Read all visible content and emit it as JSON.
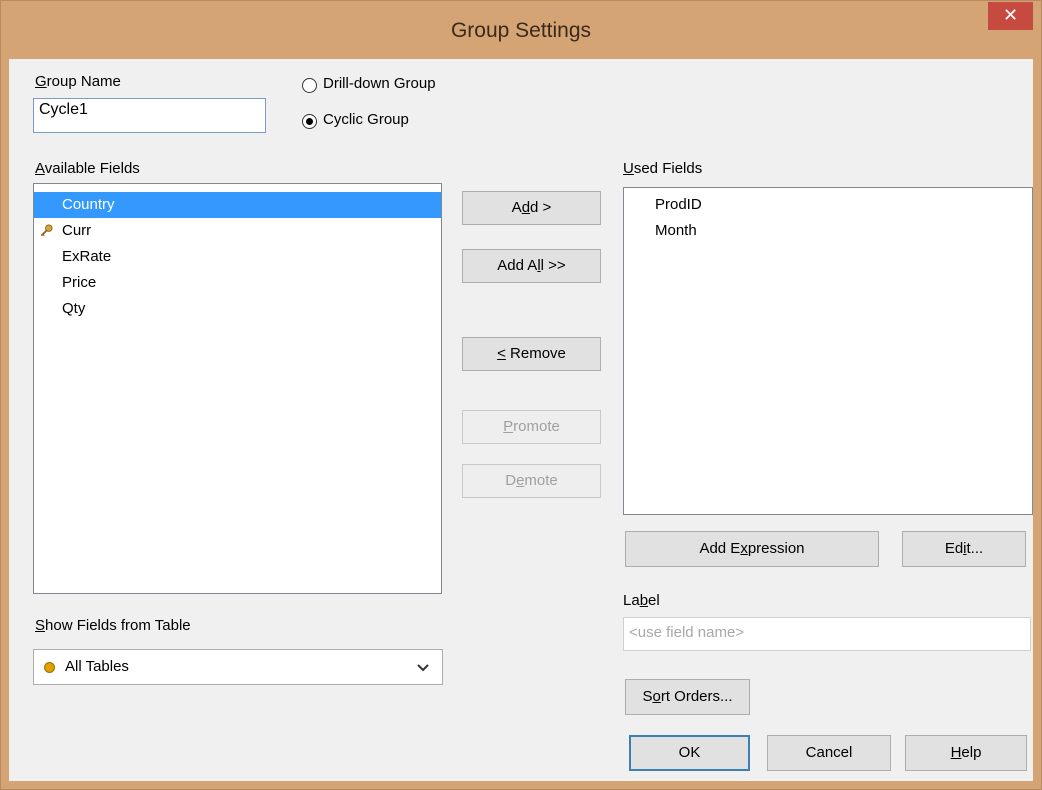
{
  "window": {
    "title": "Group Settings",
    "close_glyph": "✕"
  },
  "group_name": {
    "label_prefix": "",
    "label_key": "G",
    "label_rest": "roup Name",
    "value": "Cycle1"
  },
  "group_type": {
    "drilldown": "Drill-down Group",
    "cyclic": "Cyclic Group",
    "selected": "cyclic"
  },
  "available": {
    "label_key": "A",
    "label_rest": "vailable Fields",
    "items": [
      {
        "name": "Country",
        "selected": true,
        "key": false
      },
      {
        "name": "Curr",
        "selected": false,
        "key": true
      },
      {
        "name": "ExRate",
        "selected": false,
        "key": false
      },
      {
        "name": "Price",
        "selected": false,
        "key": false
      },
      {
        "name": "Qty",
        "selected": false,
        "key": false
      }
    ]
  },
  "buttons": {
    "add": {
      "a": "A",
      "k": "d",
      "b": "d >"
    },
    "add_all": {
      "a": "Add A",
      "k": "l",
      "b": "l >>"
    },
    "remove": {
      "a": "",
      "k": "<",
      "b": " Remove"
    },
    "promote": {
      "a": "",
      "k": "P",
      "b": "romote"
    },
    "demote": {
      "a": "D",
      "k": "e",
      "b": "mote"
    },
    "add_expression": {
      "a": "Add E",
      "k": "x",
      "b": "pression"
    },
    "edit": {
      "a": "Ed",
      "k": "i",
      "b": "t..."
    },
    "sort_orders": {
      "a": "S",
      "k": "o",
      "b": "rt Orders..."
    },
    "ok": "OK",
    "cancel": "Cancel",
    "help": {
      "a": "",
      "k": "H",
      "b": "elp"
    }
  },
  "used": {
    "label_key": "U",
    "label_rest": "sed Fields",
    "items": [
      "ProdID",
      "Month"
    ]
  },
  "label_field": {
    "label_a": "La",
    "label_key": "b",
    "label_b": "el",
    "placeholder": "<use field name>"
  },
  "show_fields": {
    "label_key": "S",
    "label_rest": "how Fields from Table",
    "value": "All Tables",
    "accent": "#e0a000"
  }
}
